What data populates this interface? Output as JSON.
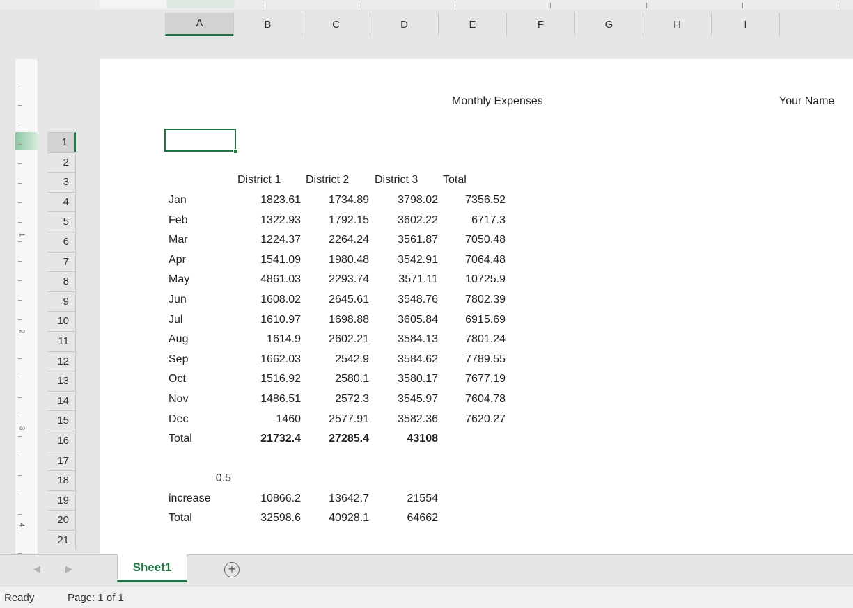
{
  "columns": [
    "A",
    "B",
    "C",
    "D",
    "E",
    "F",
    "G",
    "H",
    "I"
  ],
  "selected_column": "A",
  "rows": [
    "1",
    "2",
    "3",
    "4",
    "5",
    "6",
    "7",
    "8",
    "9",
    "10",
    "11",
    "12",
    "13",
    "14",
    "15",
    "16",
    "17",
    "18",
    "19",
    "20",
    "21"
  ],
  "selected_row": "1",
  "ruler_numbers": [
    "1",
    "2",
    "3",
    "4"
  ],
  "page_header": {
    "center": "Monthly Expenses",
    "right": "Your Name"
  },
  "table": {
    "headers": [
      "District 1",
      "District 2",
      "District 3",
      "Total"
    ],
    "months": [
      {
        "label": "Jan",
        "d1": "1823.61",
        "d2": "1734.89",
        "d3": "3798.02",
        "total": "7356.52"
      },
      {
        "label": "Feb",
        "d1": "1322.93",
        "d2": "1792.15",
        "d3": "3602.22",
        "total": "6717.3"
      },
      {
        "label": "Mar",
        "d1": "1224.37",
        "d2": "2264.24",
        "d3": "3561.87",
        "total": "7050.48"
      },
      {
        "label": "Apr",
        "d1": "1541.09",
        "d2": "1980.48",
        "d3": "3542.91",
        "total": "7064.48"
      },
      {
        "label": "May",
        "d1": "4861.03",
        "d2": "2293.74",
        "d3": "3571.11",
        "total": "10725.9"
      },
      {
        "label": "Jun",
        "d1": "1608.02",
        "d2": "2645.61",
        "d3": "3548.76",
        "total": "7802.39"
      },
      {
        "label": "Jul",
        "d1": "1610.97",
        "d2": "1698.88",
        "d3": "3605.84",
        "total": "6915.69"
      },
      {
        "label": "Aug",
        "d1": "1614.9",
        "d2": "2602.21",
        "d3": "3584.13",
        "total": "7801.24"
      },
      {
        "label": "Sep",
        "d1": "1662.03",
        "d2": "2542.9",
        "d3": "3584.62",
        "total": "7789.55"
      },
      {
        "label": "Oct",
        "d1": "1516.92",
        "d2": "2580.1",
        "d3": "3580.17",
        "total": "7677.19"
      },
      {
        "label": "Nov",
        "d1": "1486.51",
        "d2": "2572.3",
        "d3": "3545.97",
        "total": "7604.78"
      },
      {
        "label": "Dec",
        "d1": "1460",
        "d2": "2577.91",
        "d3": "3582.36",
        "total": "7620.27"
      }
    ],
    "total_row": {
      "label": "Total",
      "d1": "21732.4",
      "d2": "27285.4",
      "d3": "43108"
    },
    "rate": "0.5",
    "increase_row": {
      "label": "increase",
      "d1": "10866.2",
      "d2": "13642.7",
      "d3": "21554"
    },
    "new_total_row": {
      "label": "Total",
      "d1": "32598.6",
      "d2": "40928.1",
      "d3": "64662"
    }
  },
  "sheet_tab": "Sheet1",
  "add_sheet_symbol": "+",
  "nav_prev_symbol": "◀",
  "nav_next_symbol": "▶",
  "status": {
    "ready": "Ready",
    "page": "Page: 1 of 1"
  },
  "colors": {
    "accent": "#217346"
  }
}
